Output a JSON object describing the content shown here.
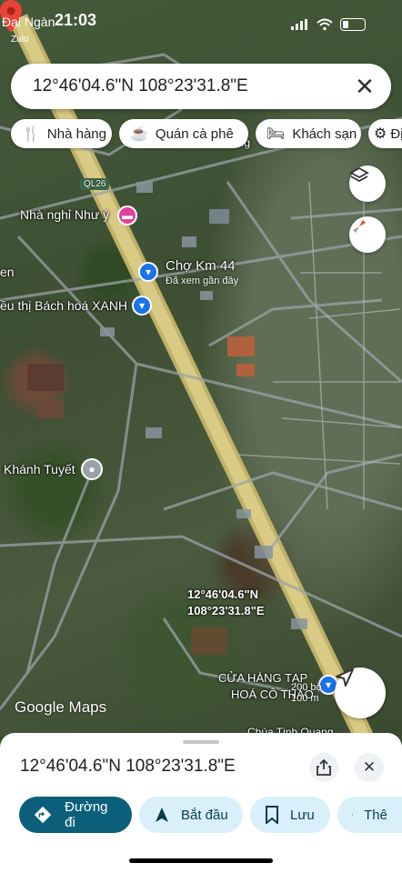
{
  "status_bar": {
    "left_text": "Đại Ngàn",
    "time": "21:03",
    "back_app": "Zalo"
  },
  "search": {
    "value": "12°46'04.6\"N 108°23'31.8\"E",
    "close_icon": "close-icon"
  },
  "chips": [
    {
      "icon": "restaurant-icon",
      "glyph": "🍴",
      "label": "Nhà hàng"
    },
    {
      "icon": "coffee-icon",
      "glyph": "☕",
      "label": "Quán cà phê"
    },
    {
      "icon": "hotel-icon",
      "glyph": "🛏",
      "label": "Khách sạn"
    },
    {
      "icon": "attraction-icon",
      "glyph": "⚙",
      "label": "Đị"
    }
  ],
  "map": {
    "road_label": "QL26",
    "places": [
      {
        "name": "Nhà nghỉ Như ý",
        "icon": "hotel-pin-icon",
        "color": "#e040a0"
      },
      {
        "name": "Chợ Km 44",
        "sub": "Đã xem gần đây",
        "icon": "shopping-pin-icon",
        "color": "#1a73e8"
      },
      {
        "name": "ều thị Bách hoá XANH",
        "icon": "store-pin-icon",
        "color": "#1a73e8"
      },
      {
        "name": "Khánh Tuyết",
        "icon": "place-pin-icon",
        "color": "#9aa0a6"
      },
      {
        "name": "CỬA HÀNG TẠP",
        "name2": "HOÁ CÔ THẢO",
        "icon": "store-pin-icon",
        "color": "#1a73e8"
      }
    ],
    "partial_labels": [
      "ong",
      "en",
      "Chùa Tịnh Quang"
    ],
    "pin_label_line1": "12°46'04.6\"N",
    "pin_label_line2": "108°23'31.8\"E",
    "scale_ft": "200 bộ",
    "scale_m": "100 m",
    "attribution": "Google Maps"
  },
  "sheet": {
    "title": "12°46'04.6\"N 108°23'31.8\"E",
    "actions": [
      {
        "icon": "directions-icon",
        "label": "Đường đi",
        "primary": true
      },
      {
        "icon": "navigate-icon",
        "label": "Bắt đầu",
        "primary": false
      },
      {
        "icon": "bookmark-icon",
        "label": "Lưu",
        "primary": false
      },
      {
        "icon": "flag-icon",
        "label": "Thê",
        "primary": false
      }
    ]
  },
  "colors": {
    "primary": "#0b5f7a",
    "chip_bg": "#d9f0fb",
    "pin": "#ea4335",
    "road": "#d4c27a"
  }
}
